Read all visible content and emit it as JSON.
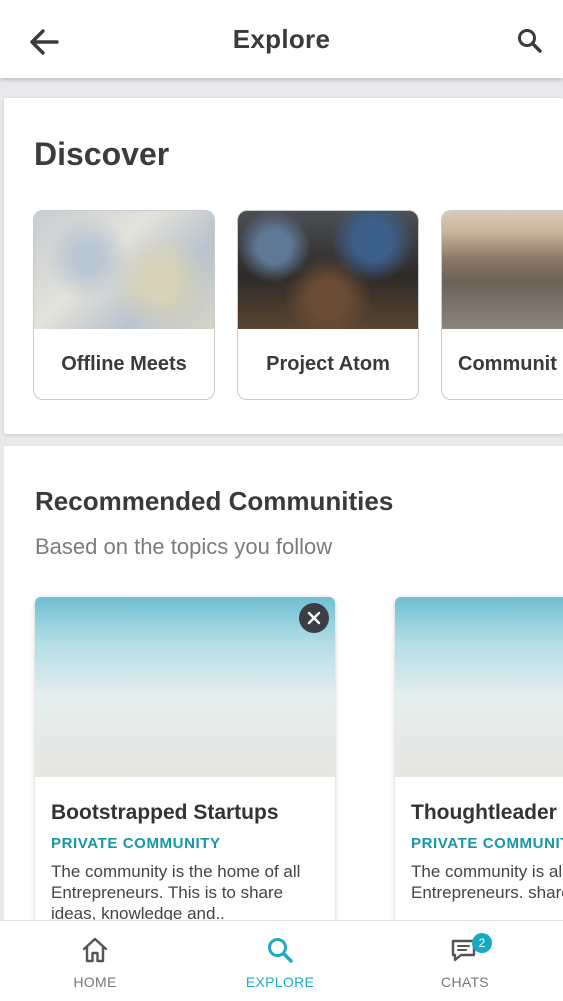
{
  "header": {
    "title": "Explore",
    "back_icon": "arrow-left-icon",
    "search_icon": "search-icon"
  },
  "discover": {
    "title": "Discover",
    "tiles": [
      {
        "label": "Offline Meets",
        "image": "map-pins-photo"
      },
      {
        "label": "Project Atom",
        "image": "crowd-event-photo"
      },
      {
        "label": "Communit",
        "image": "campfire-group-photo"
      }
    ]
  },
  "recommended": {
    "title": "Recommended Communities",
    "subtitle": "Based on the topics you follow",
    "cards": [
      {
        "name": "Bootstrapped Startups",
        "type": "PRIVATE COMMUNITY",
        "description": "The community is the home of all Entrepreneurs. This is to share ideas, knowledge and.."
      },
      {
        "name": "Thoughtleader",
        "type": "PRIVATE COMMUNIT",
        "description": "The community is all Entrepreneurs. share ideas, know"
      }
    ]
  },
  "bottom_nav": {
    "items": [
      {
        "label": "HOME",
        "icon": "home-icon"
      },
      {
        "label": "EXPLORE",
        "icon": "search-icon",
        "active": true
      },
      {
        "label": "CHATS",
        "icon": "chat-icon",
        "badge": "2"
      }
    ]
  },
  "colors": {
    "accent": "#1fa9c4",
    "tag": "#1697a8",
    "badge": "#18a9c2"
  }
}
